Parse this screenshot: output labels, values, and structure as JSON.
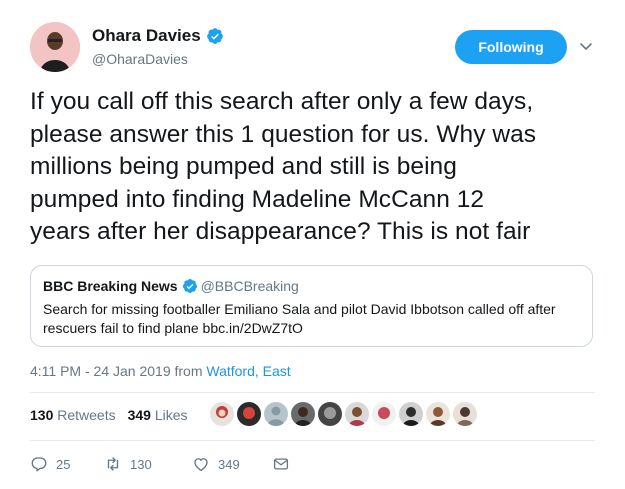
{
  "author": {
    "name": "Ohara Davies",
    "handle": "@OharaDavies"
  },
  "follow_button": "Following",
  "tweet": {
    "lines": [
      "If you call off this search after only a few days,",
      "please answer this 1 question for us. Why was",
      "millions being pumped and still is being",
      "pumped into finding Madeline McCann 12",
      "years after her disappearance? This is not fair"
    ]
  },
  "quoted": {
    "name": "BBC Breaking News",
    "handle": "@BBCBreaking",
    "lines": [
      "Search for missing footballer Emiliano Sala and pilot David Ibbotson called off after",
      "rescuers fail to find plane bbc.in/2DwZ7tO"
    ]
  },
  "meta": {
    "time": "4:11 PM - 24 Jan 2019 from ",
    "location": "Watford, East"
  },
  "stats": {
    "retweets_count": "130",
    "retweets_label": "Retweets",
    "likes_count": "349",
    "likes_label": "Likes"
  },
  "actions": {
    "replies": "25",
    "retweets": "130",
    "likes": "349"
  },
  "colors": {
    "accent": "#1da1f2",
    "link": "#1b95e0",
    "muted": "#657786"
  },
  "icons": [
    "verified-badge-icon",
    "chevron-down-icon",
    "reply-icon",
    "retweet-icon",
    "heart-icon",
    "direct-message-icon"
  ]
}
